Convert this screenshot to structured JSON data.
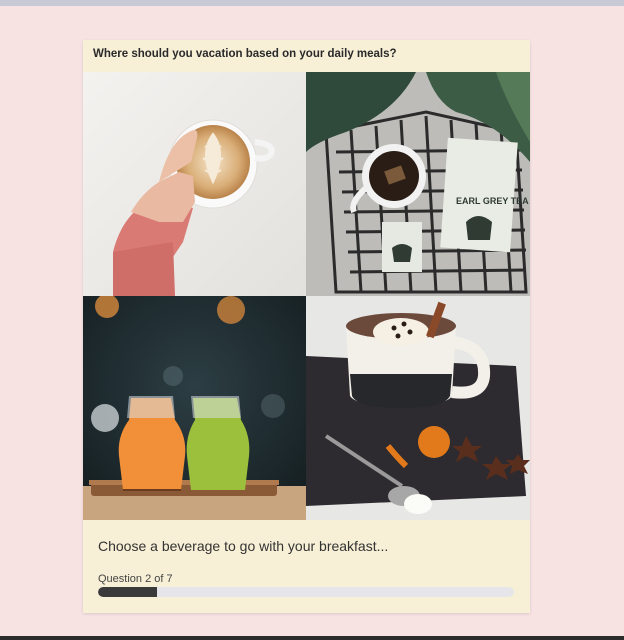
{
  "quiz": {
    "title": "Where should you vacation based on your daily meals?",
    "prompt": "Choose a beverage to go with your breakfast...",
    "progress_label": "Question 2 of 7",
    "progress_fraction": 0.143
  },
  "options": [
    {
      "icon": "latte-photo"
    },
    {
      "icon": "earl-grey-tea-photo"
    },
    {
      "icon": "juice-photo"
    },
    {
      "icon": "hot-chocolate-photo"
    }
  ],
  "photo_text": {
    "tea_box": "EARL GREY TEA"
  },
  "colors": {
    "background": "#f8e3e3",
    "card": "#f7efd6",
    "progress_fill": "#3a3a3a",
    "progress_track": "#e6e6ea"
  }
}
